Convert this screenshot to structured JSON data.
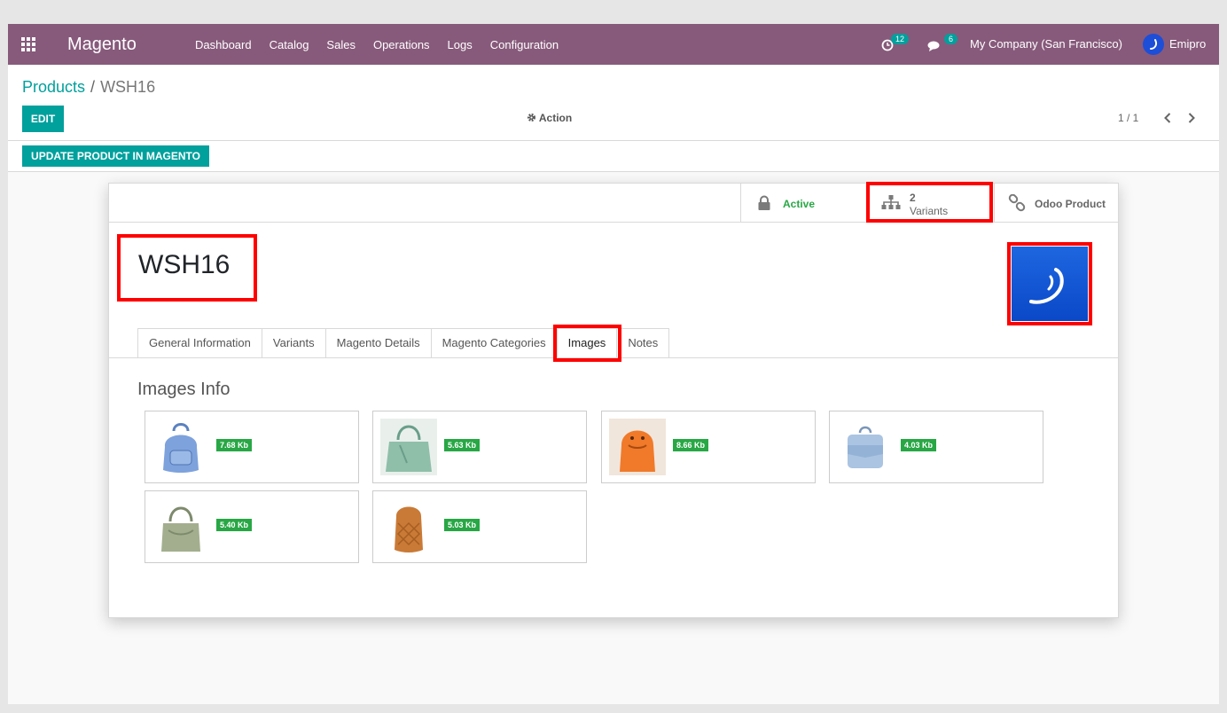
{
  "navbar": {
    "brand": "Magento",
    "menu": [
      "Dashboard",
      "Catalog",
      "Sales",
      "Operations",
      "Logs",
      "Configuration"
    ],
    "activity_count": "12",
    "message_count": "6",
    "company": "My Company (San Francisco)",
    "user": "Emipro",
    "bg_color": "#875a7b"
  },
  "breadcrumb": {
    "parent": "Products",
    "separator": "/",
    "current": "WSH16"
  },
  "control": {
    "edit_label": "EDIT",
    "action_label": "Action",
    "pager": "1 / 1"
  },
  "statusbar": {
    "update_label": "UPDATE PRODUCT IN MAGENTO"
  },
  "stat_buttons": {
    "active_label": "Active",
    "variants_count": "2",
    "variants_label": "Variants",
    "odoo_label": "Odoo Product"
  },
  "record": {
    "title": "WSH16"
  },
  "tabs": [
    "General Information",
    "Variants",
    "Magento Details",
    "Magento Categories",
    "Images",
    "Notes"
  ],
  "active_tab": "Images",
  "images_section": {
    "title": "Images Info",
    "images": [
      {
        "size": "7.68 Kb"
      },
      {
        "size": "5.63 Kb"
      },
      {
        "size": "8.66 Kb"
      },
      {
        "size": "4.03 Kb"
      },
      {
        "size": "5.40 Kb"
      },
      {
        "size": "5.03 Kb"
      }
    ]
  },
  "colors": {
    "accent": "#00a09d",
    "highlight": "#ff0000",
    "badge_green": "#28a745"
  }
}
